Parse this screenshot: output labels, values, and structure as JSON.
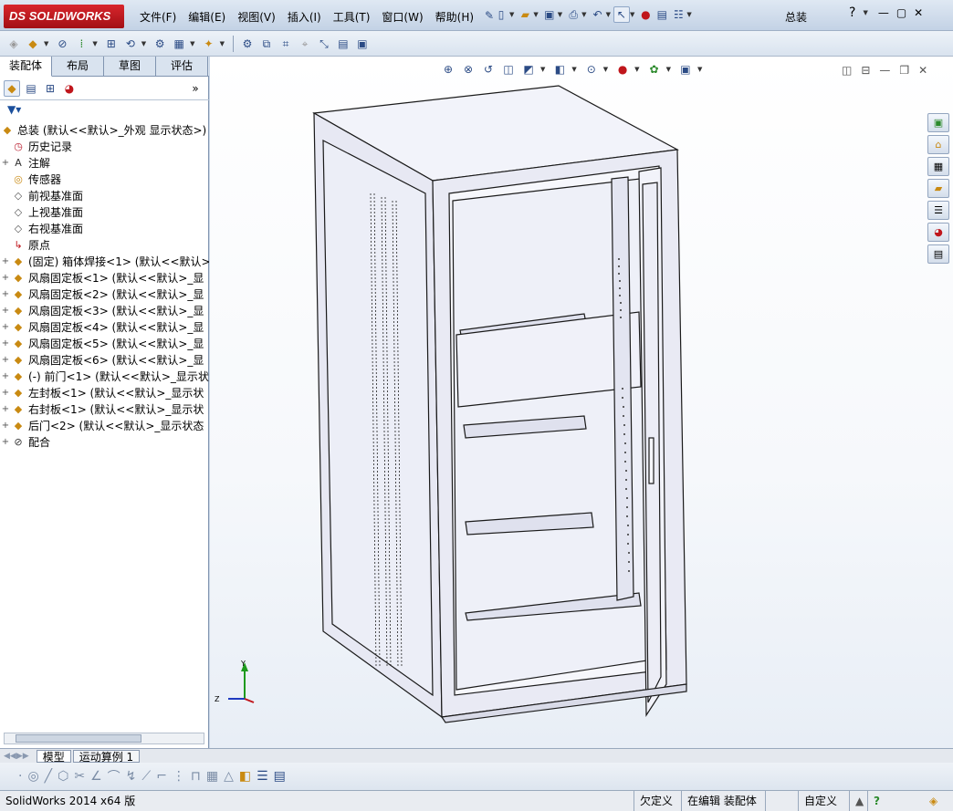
{
  "app": {
    "logo_prefix": "DS",
    "logo_text": "SOLIDWORKS",
    "document_title": "总装"
  },
  "menus": [
    "文件(F)",
    "编辑(E)",
    "视图(V)",
    "插入(I)",
    "工具(T)",
    "窗口(W)",
    "帮助(H)"
  ],
  "help_button": "?",
  "panel_tabs": [
    "装配体",
    "布局",
    "草图",
    "评估"
  ],
  "tree": {
    "root": "总装  (默认<<默认>_外观 显示状态>)",
    "items": [
      {
        "label": "历史记录",
        "icon": "history-icon",
        "expand": ""
      },
      {
        "label": "注解",
        "icon": "annotation-icon",
        "expand": "+"
      },
      {
        "label": "传感器",
        "icon": "sensor-icon",
        "expand": ""
      },
      {
        "label": "前视基准面",
        "icon": "plane-icon",
        "expand": ""
      },
      {
        "label": "上视基准面",
        "icon": "plane-icon",
        "expand": ""
      },
      {
        "label": "右视基准面",
        "icon": "plane-icon",
        "expand": ""
      },
      {
        "label": "原点",
        "icon": "origin-icon",
        "expand": ""
      },
      {
        "label": "(固定) 箱体焊接<1> (默认<<默认>",
        "icon": "part-icon",
        "expand": "+"
      },
      {
        "label": "风扇固定板<1> (默认<<默认>_显",
        "icon": "part-icon",
        "expand": "+"
      },
      {
        "label": "风扇固定板<2> (默认<<默认>_显",
        "icon": "part-icon",
        "expand": "+"
      },
      {
        "label": "风扇固定板<3> (默认<<默认>_显",
        "icon": "part-icon",
        "expand": "+"
      },
      {
        "label": "风扇固定板<4> (默认<<默认>_显",
        "icon": "part-icon",
        "expand": "+"
      },
      {
        "label": "风扇固定板<5> (默认<<默认>_显",
        "icon": "part-icon",
        "expand": "+"
      },
      {
        "label": "风扇固定板<6> (默认<<默认>_显",
        "icon": "part-icon",
        "expand": "+"
      },
      {
        "label": "(-) 前门<1> (默认<<默认>_显示状",
        "icon": "part-icon",
        "expand": "+"
      },
      {
        "label": "左封板<1> (默认<<默认>_显示状",
        "icon": "part-icon",
        "expand": "+"
      },
      {
        "label": "右封板<1> (默认<<默认>_显示状",
        "icon": "part-icon",
        "expand": "+"
      },
      {
        "label": "后门<2> (默认<<默认>_显示状态",
        "icon": "part-icon",
        "expand": "+"
      },
      {
        "label": "配合",
        "icon": "mates-icon",
        "expand": "+"
      }
    ]
  },
  "bottom_tabs": [
    "模型",
    "运动算例 1"
  ],
  "status": {
    "app_version": "SolidWorks 2014 x64 版",
    "defined": "欠定义",
    "editing": "在编辑 装配体",
    "units": "自定义"
  },
  "triad": {
    "y": "Y",
    "z": "Z"
  },
  "colors": {
    "accent": "#2b4b85",
    "logo_red": "#c0161c",
    "cabinet_body": "#eeeff8",
    "cabinet_edge": "#1a1a1a"
  }
}
